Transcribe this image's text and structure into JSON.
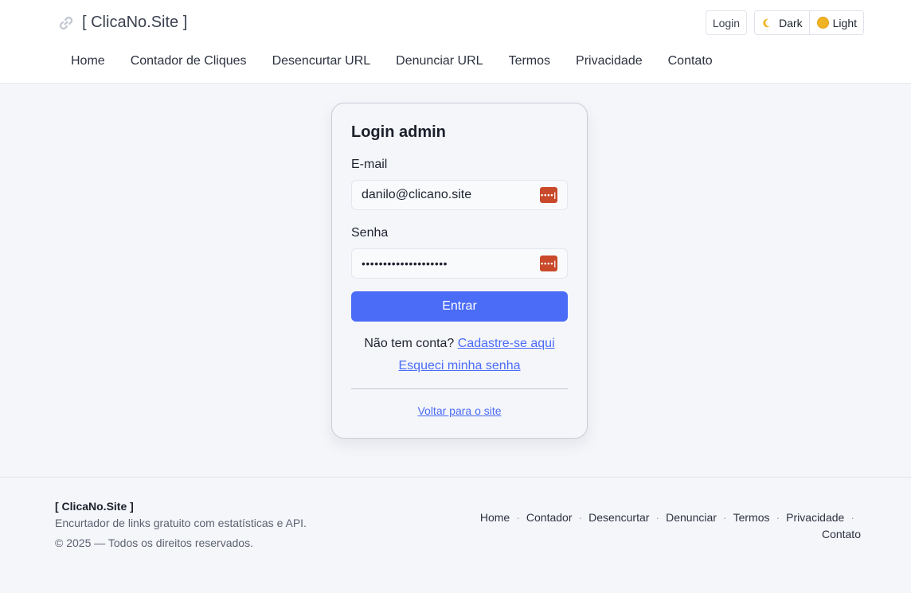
{
  "header": {
    "brand": "[ ClicaNo.Site ]",
    "login_label": "Login",
    "theme": {
      "dark_label": "Dark",
      "light_label": "Light"
    },
    "nav": [
      "Home",
      "Contador de Cliques",
      "Desencurtar URL",
      "Denunciar URL",
      "Termos",
      "Privacidade",
      "Contato"
    ]
  },
  "login": {
    "title": "Login admin",
    "email_label": "E-mail",
    "email_value": "danilo@clicano.site",
    "password_label": "Senha",
    "password_value": "••••••••••••••••••••",
    "submit_label": "Entrar",
    "signup_text": "Não tem conta?",
    "signup_link": "Cadastre-se aqui",
    "forgot_link": "Esqueci minha senha",
    "back_link": "Voltar para o site",
    "password_manager_icon": "••••|"
  },
  "footer": {
    "brand": "[ ClicaNo.Site ]",
    "description": "Encurtador de links gratuito com estatísticas e API.",
    "copyright": "© 2025 — Todos os direitos reservados.",
    "links": [
      "Home",
      "Contador",
      "Desencurtar",
      "Denunciar",
      "Termos",
      "Privacidade",
      "Contato"
    ],
    "separator": "·"
  },
  "colors": {
    "accent": "#4a6cf7",
    "password_manager": "#c9492b",
    "sun": "#f0b323"
  },
  "icons": {
    "brand": "link-icon",
    "dark": "moon-icon",
    "light": "sun-icon",
    "password": "password-manager-icon"
  }
}
